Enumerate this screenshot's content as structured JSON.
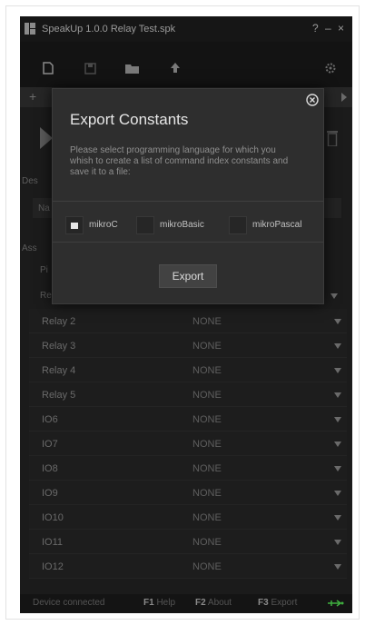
{
  "titlebar": {
    "title": "SpeakUp 1.0.0  Relay Test.spk",
    "help": "?",
    "minimize": "–",
    "close": "×"
  },
  "background": {
    "description_label": "Des",
    "assignment_label": "Ass",
    "field_prefix": "Na",
    "header_prefix": "Pi",
    "row1_prefix": "Re"
  },
  "rows": [
    {
      "label": "Relay 2",
      "value": "NONE"
    },
    {
      "label": "Relay 3",
      "value": "NONE"
    },
    {
      "label": "Relay 4",
      "value": "NONE"
    },
    {
      "label": "Relay 5",
      "value": "NONE"
    },
    {
      "label": "IO6",
      "value": "NONE"
    },
    {
      "label": "IO7",
      "value": "NONE"
    },
    {
      "label": "IO8",
      "value": "NONE"
    },
    {
      "label": "IO9",
      "value": "NONE"
    },
    {
      "label": "IO10",
      "value": "NONE"
    },
    {
      "label": "IO11",
      "value": "NONE"
    },
    {
      "label": "IO12",
      "value": "NONE"
    }
  ],
  "statusbar": {
    "status": "Device connected",
    "help_key": "F1",
    "help_label": "Help",
    "about_key": "F2",
    "about_label": "About",
    "export_key": "F3",
    "export_label": "Export"
  },
  "modal": {
    "title": "Export Constants",
    "description": "Please select programming language for which you whish to create a list of command index constants and save it to a file:",
    "languages": [
      {
        "label": "mikroC",
        "checked": true
      },
      {
        "label": "mikroBasic",
        "checked": false
      },
      {
        "label": "mikroPascal",
        "checked": false
      }
    ],
    "export_label": "Export"
  },
  "colors": {
    "app_bg": "#1b1b1b",
    "modal_bg": "#2e2e2e",
    "status_connected": "#3fae3f"
  }
}
